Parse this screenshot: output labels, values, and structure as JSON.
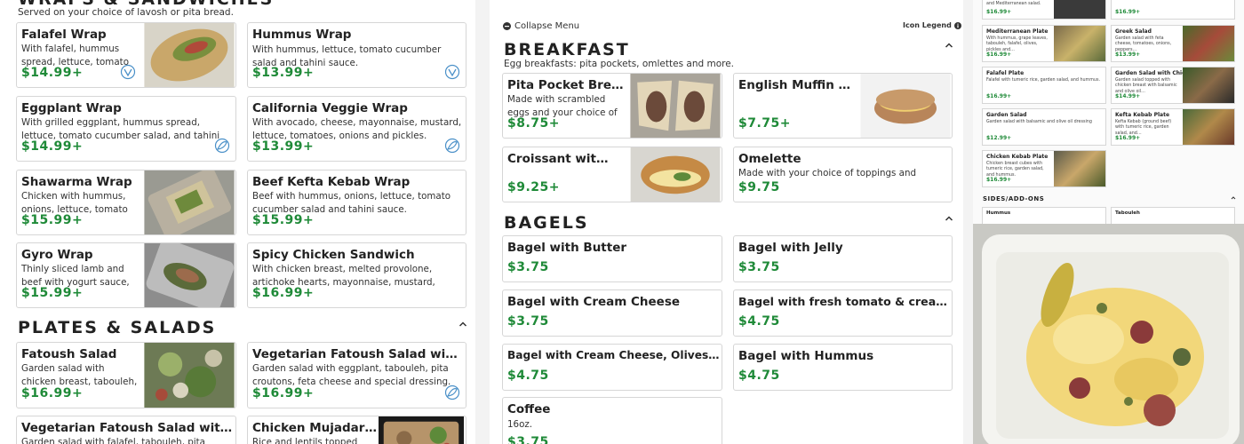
{
  "wraps": {
    "title": "WRAPS & SANDWICHES",
    "subtitle": "Served on your choice of lavosh or pita bread.",
    "items": [
      {
        "name": "Falafel Wrap",
        "desc": "With falafel, hummus spread, lettuce, tomato cucumber salad, a…",
        "price": "$14.99+"
      },
      {
        "name": "Hummus Wrap",
        "desc": "With hummus, lettuce, tomato cucumber salad and tahini sauce.",
        "price": "$13.99+"
      },
      {
        "name": "Eggplant Wrap",
        "desc": "With grilled eggplant, hummus spread, lettuce, tomato cucumber salad, and tahini sauce.",
        "price": "$14.99+"
      },
      {
        "name": "California Veggie Wrap",
        "desc": "With avocado, cheese, mayonnaise, mustard, lettuce, tomatoes, onions and pickles.",
        "price": "$13.99+"
      },
      {
        "name": "Shawarma Wrap",
        "desc": "Chicken with hummus, onions, lettuce, tomato cucumber salad an…",
        "price": "$15.99+"
      },
      {
        "name": "Beef Kefta Kebab Wrap",
        "desc": "Beef with hummus, onions, lettuce, tomato cucumber salad and tahini sauce.",
        "price": "$15.99+"
      },
      {
        "name": "Gyro Wrap",
        "desc": "Thinly sliced lamb and beef with yogurt sauce, lettuce, tomatoes an…",
        "price": "$15.99+"
      },
      {
        "name": "Spicy Chicken Sandwich",
        "desc": "With chicken breast, melted provolone, artichoke hearts, mayonnaise, mustard, lettuce, tomatoes, onions and pickles.",
        "price": "$16.99+"
      }
    ]
  },
  "plates": {
    "title": "PLATES & SALADS",
    "items": [
      {
        "name": "Fatoush Salad",
        "desc": "Garden salad with chicken breast, tabouleh, pita croutons, feta chees…",
        "price": "$16.99+"
      },
      {
        "name": "Vegetarian Fatoush Salad with Eggplant",
        "desc": "Garden salad with eggplant, tabouleh, pita croutons, feta cheese and special dressing.",
        "price": "$16.99+"
      },
      {
        "name": "Vegetarian Fatoush Salad with Falafel",
        "desc": "Garden salad with falafel, tabouleh, pita croutons, feta cheese",
        "price": ""
      },
      {
        "name": "Chicken Mujadarrah Plate",
        "desc": "Rice and lentils topped with chicken",
        "price": ""
      }
    ]
  },
  "menu": {
    "collapse_label": "Collapse Menu",
    "legend_label": "Icon Legend"
  },
  "breakfast": {
    "title": "BREAKFAST",
    "subtitle": "Egg breakfasts: pita pockets, omlettes and more.",
    "items": [
      {
        "name": "Pita Pocket Breakfast",
        "desc": "Made with scrambled eggs and your choice of fillings.",
        "price": "$8.75+"
      },
      {
        "name": "English Muffin with Egg & Cheese",
        "desc": "",
        "price": "$7.75+"
      },
      {
        "name": "Croissant with Egg & Cheese",
        "desc": "",
        "price": "$9.25+"
      },
      {
        "name": "Omelette",
        "desc": "Made with your choice of toppings and served with toast.",
        "price": "$9.75"
      }
    ]
  },
  "bagels": {
    "title": "BAGELS",
    "items": [
      {
        "name": "Bagel with Butter",
        "desc": "",
        "price": "$3.75"
      },
      {
        "name": "Bagel with Jelly",
        "desc": "",
        "price": "$3.75"
      },
      {
        "name": "Bagel with Cream Cheese",
        "desc": "",
        "price": "$3.75"
      },
      {
        "name": "Bagel with fresh tomato & cream cheese",
        "desc": "",
        "price": "$4.75"
      },
      {
        "name": "Bagel with Cream Cheese, Olives & Artichokes",
        "desc": "",
        "price": "$4.75"
      },
      {
        "name": "Bagel with Hummus",
        "desc": "",
        "price": "$4.75"
      },
      {
        "name": "Coffee",
        "desc": "16oz.",
        "price": "$3.75"
      }
    ]
  },
  "mini": {
    "top_left_text": "and Mediterranean salad.",
    "top_left_price": "$16.99+",
    "top_right_price": "$16.99+",
    "items": [
      {
        "name": "Mediterranean Plate",
        "desc": "With hummus, grape leaves, tabouleh, falafel, olives, pickles and…",
        "price": "$16.99+"
      },
      {
        "name": "Greek Salad",
        "desc": "Garden salad with feta cheese, tomatoes, onions, peppers…",
        "price": "$13.99+"
      },
      {
        "name": "Falafel Plate",
        "desc": "Falafel with tumeric rice, garden salad, and hummus.",
        "price": "$16.99+"
      },
      {
        "name": "Garden Salad with Chicken",
        "desc": "Garden salad topped with chicken breast with balsamic and olive oil…",
        "price": "$14.99+"
      },
      {
        "name": "Garden Salad",
        "desc": "Garden salad with balsamic and olive oil dressing",
        "price": "$12.99+"
      },
      {
        "name": "Kefta Kebab Plate",
        "desc": "Kefta Kebab (ground beef) with tumeric rice, garden salad, and…",
        "price": "$16.99+"
      },
      {
        "name": "Chicken Kebab Plate",
        "desc": "Chicken breast cubes with tumeric rice, garden salad, and hummus.",
        "price": "$16.99+"
      }
    ],
    "sides_title": "SIDES/ADD-ONS",
    "sides": [
      "Hummus",
      "Tabouleh"
    ]
  }
}
